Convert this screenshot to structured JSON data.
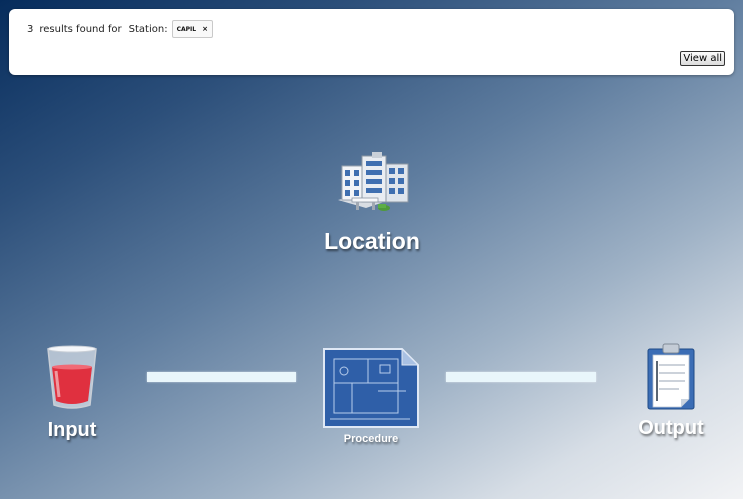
{
  "search": {
    "count": "3",
    "results_text": "results found for",
    "filter_label": "Station:",
    "filter_value": "CAPIL",
    "remove_symbol": "×",
    "view_all_label": "View all"
  },
  "workflow": {
    "location": {
      "label": "Location",
      "icon": "building-icon"
    },
    "input": {
      "label": "Input",
      "icon": "glass-icon"
    },
    "procedure": {
      "label": "Procedure",
      "icon": "blueprint-icon"
    },
    "output": {
      "label": "Output",
      "icon": "clipboard-icon"
    }
  },
  "colors": {
    "background_dark": "#062c5c",
    "background_light": "#f2f3f5",
    "connector": "#e9f6fb"
  }
}
